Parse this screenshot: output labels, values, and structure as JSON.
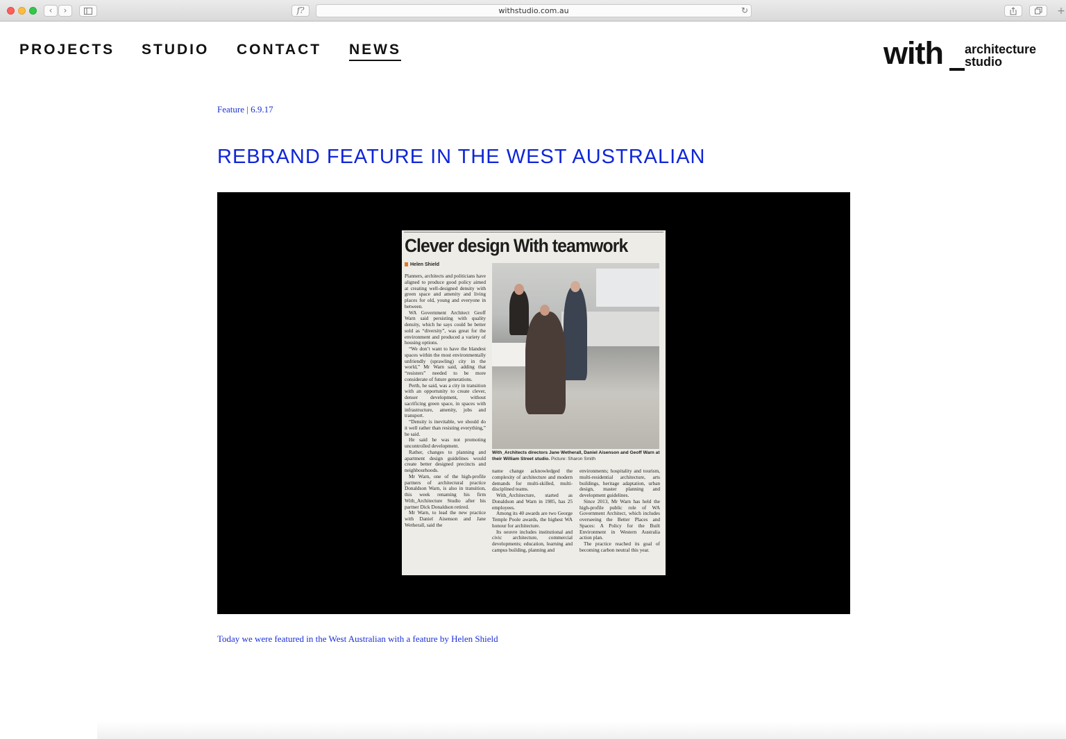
{
  "browser": {
    "url": "withstudio.com.au",
    "font_button": "f?",
    "reload_icon": "reload-icon",
    "new_tab_glyph": "+"
  },
  "nav": {
    "items": [
      {
        "label": "PROJECTS"
      },
      {
        "label": "STUDIO"
      },
      {
        "label": "CONTACT"
      },
      {
        "label": "NEWS",
        "active": true
      }
    ]
  },
  "logo": {
    "word": "with",
    "line1": "architecture",
    "line2": "studio"
  },
  "article": {
    "meta": "Feature | 6.9.17",
    "title": "REBRAND FEATURE IN THE WEST AUSTRALIAN",
    "intro": "Today we were featured in the West Australian with a feature by Helen Shield"
  },
  "clipping": {
    "headline": "Clever design With teamwork",
    "byline": "Helen Shield",
    "caption_bold": "With_Architects directors Jane Wetherall, Daniel Aisenson and Geoff Warn at their William Street studio.",
    "caption_credit": "Picture: Sharon Smith",
    "col1": [
      "Planners, architects and politicians have aligned to produce good policy aimed at creating well-designed density with green space and amenity and living places for old, young and everyone in between.",
      "WA Government Architect Geoff Warn said persisting with quality density, which he says could be better sold as “diversity”, was great for the environment and produced a variety of housing options.",
      "“We don’t want to have the blandest spaces within the most environmentally unfriendly (sprawling) city in the world,” Mr Warn said, adding that “resisters” needed to be more considerate of future generations.",
      "Perth, he said, was a city in transition with an opportunity to create clever, denser development, without sacrificing green space, in spaces with infrastructure, amenity, jobs and transport.",
      "“Density is inevitable, we should do it well rather than resisting everything,” he said.",
      "He said he was not promoting uncontrolled development.",
      "Rather, changes to planning and apartment design guidelines would create better designed precincts and neighbourhoods.",
      "Mr Warn, one of the high-profile partners of architectural practice Donaldson Warn, is also in transition, this week renaming his firm With_Architecture Studio after his partner Dick Donaldson retired.",
      "Mr Warn, to lead the new practice with Daniel Aisenson and Jane Wetherall, said the"
    ],
    "col2": [
      "name change acknowledged the complexity of architecture and modern demands for multi-skilled, multi-disciplined teams.",
      "With_Architecture, started as Donaldson and Warn in 1985, has 25 employees.",
      "Among its 40 awards are two George Temple Poole awards, the highest WA honour for architecture.",
      "Its oeuvre includes institutional and civic architecture, commercial developments; education, learning and campus building, planning and"
    ],
    "col3": [
      "environments; hospitality and tourism, multi-residential architecture, arts buildings, heritage adaptation, urban design, master planning and development guidelines.",
      "Since 2013, Mr Warn has held the high-profile public role of WA Government Architect, which includes overseeing the Better Places and Spaces: A Policy for the Built Environment in Western Australia action plan.",
      "The practice reached its goal of becoming carbon neutral this year."
    ]
  },
  "colors": {
    "link_blue": "#1a2fd6",
    "title_blue": "#0f25d8",
    "text_black": "#111111",
    "media_bg": "#000000"
  }
}
